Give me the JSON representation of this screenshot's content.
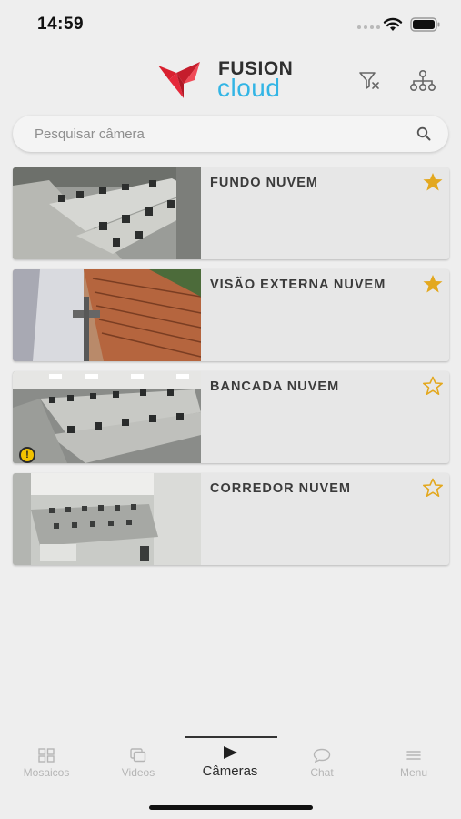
{
  "status_bar": {
    "time": "14:59"
  },
  "header": {
    "logo_word_1": "FUSION",
    "logo_word_2": "cloud"
  },
  "search": {
    "placeholder": "Pesquisar câmera",
    "value": ""
  },
  "cameras": [
    {
      "name": "FUNDO NUVEM",
      "favorite": true,
      "warning": false
    },
    {
      "name": "VISÃO EXTERNA NUVEM",
      "favorite": true,
      "warning": false
    },
    {
      "name": "BANCADA NUVEM",
      "favorite": false,
      "warning": true
    },
    {
      "name": "CORREDOR NUVEM",
      "favorite": false,
      "warning": false
    }
  ],
  "warning_symbol": "!",
  "tabs": [
    {
      "label": "Mosaicos",
      "icon": "grid-icon",
      "active": false
    },
    {
      "label": "Videos",
      "icon": "videos-icon",
      "active": false
    },
    {
      "label": "Câmeras",
      "icon": "play-icon",
      "active": true
    },
    {
      "label": "Chat",
      "icon": "chat-bubble-icon",
      "active": false
    },
    {
      "label": "Menu",
      "icon": "menu-icon",
      "active": false
    }
  ],
  "colors": {
    "star": "#e3a81f",
    "accent": "#33b5e5",
    "logo_red": "#e5283a"
  }
}
